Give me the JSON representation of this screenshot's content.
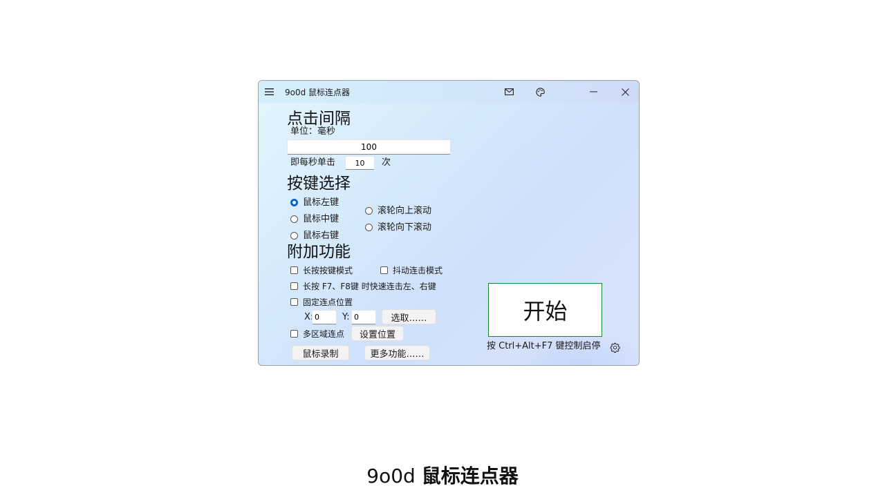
{
  "window": {
    "title": "9o0d 鼠标连点器",
    "icons": [
      "hamburger-icon",
      "mail-icon",
      "palette-icon",
      "minimize-icon",
      "close-icon"
    ]
  },
  "interval": {
    "heading": "点击间隔",
    "unit_label": "单位：毫秒",
    "value": "100",
    "per_second_prefix": "即每秒单击",
    "per_second_value": "10",
    "per_second_suffix": "次"
  },
  "keys": {
    "heading": "按键选择",
    "options": [
      {
        "label": "鼠标左键",
        "selected": true
      },
      {
        "label": "鼠标中键",
        "selected": false
      },
      {
        "label": "鼠标右键",
        "selected": false
      },
      {
        "label": "滚轮向上滚动",
        "selected": false
      },
      {
        "label": "滚轮向下滚动",
        "selected": false
      }
    ]
  },
  "extras": {
    "heading": "附加功能",
    "long_press_mode": "长按按键模式",
    "jitter_mode": "抖动连击模式",
    "f7f8_hold": "长按 F7、F8键 时快速连击左、右键",
    "fixed_position": "固定连点位置",
    "x_label": "X:",
    "x_value": "0",
    "y_label": "Y:",
    "y_value": "0",
    "select_button": "选取……",
    "multi_region": "多区域连点",
    "set_position_button": "设置位置",
    "record_button": "鼠标录制",
    "more_button": "更多功能……"
  },
  "start": {
    "button_label": "开始",
    "hotkey_hint": "按 Ctrl+Alt+F7 键控制启停"
  },
  "caption": {
    "prefix": "9o0d",
    "name": "鼠标连点器"
  },
  "colors": {
    "accent": "#0a64c8",
    "start_border": "#1b8a2e"
  }
}
